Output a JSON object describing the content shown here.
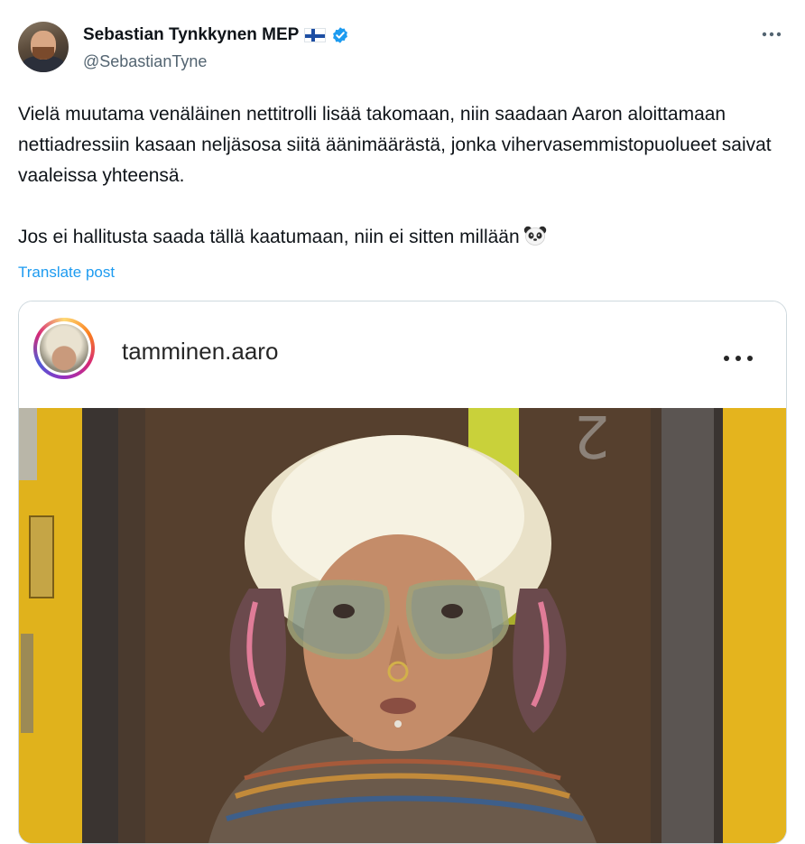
{
  "tweet": {
    "author": {
      "display_name": "Sebastian Tynkkynen MEP",
      "handle": "@SebastianTyne",
      "flag_icon": "finland-flag-icon",
      "verified_icon": "verified-badge-icon",
      "verified_color": "#1d9bf0"
    },
    "more_icon": "more-options-icon",
    "text_paragraph_1": "Vielä muutama venäläinen nettitrolli lisää takomaan, niin saadaan Aaron aloittamaan nettiadressiin kasaan neljäsosa siitä äänimäärästä, jonka vihervasemmistopuolueet saivat vaaleissa yhteensä.",
    "text_paragraph_2": "Jos ei hallitusta saada tällä kaatumaan, niin ei sitten millään",
    "emoji": "panda-emoji",
    "translate_label": "Translate post",
    "link_color": "#1d9bf0"
  },
  "embedded_post": {
    "username": "tamminen.aaro",
    "more_icon": "more-options-icon",
    "photo": "selfie-photo"
  }
}
